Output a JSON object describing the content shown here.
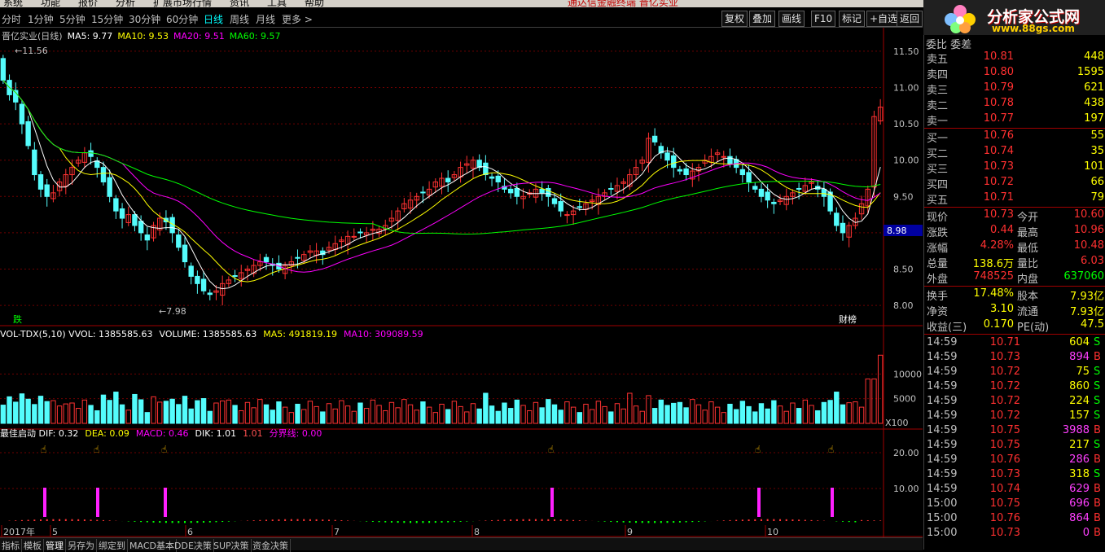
{
  "menu": {
    "items": [
      "系统",
      "功能",
      "报价",
      "分析",
      "扩展市场行情",
      "资讯",
      "工具",
      "帮助"
    ],
    "center": "通达信金融终端   晋亿实业"
  },
  "logo": {
    "title": "分析家公式网",
    "url": "www.88gs.com"
  },
  "toolbar": {
    "periods": [
      "分时",
      "1分钟",
      "5分钟",
      "15分钟",
      "30分钟",
      "60分钟",
      "日线",
      "周线",
      "月线",
      "更多 >"
    ],
    "active_period": "日线",
    "buttons": [
      "复权",
      "叠加",
      "画线",
      "F10",
      "标记",
      "+自选",
      "返回"
    ]
  },
  "main_chart": {
    "legend_title": "晋亿实业(日线)",
    "ma": [
      {
        "label": "MA5: 9.77",
        "color": "#ffffff"
      },
      {
        "label": "MA10: 9.53",
        "color": "#ffff00"
      },
      {
        "label": "MA20: 9.51",
        "color": "#ff00ff"
      },
      {
        "label": "MA60: 9.57",
        "color": "#00ff00"
      }
    ],
    "high_label": "11.56",
    "low_label": "7.98",
    "current_marker": "8.98",
    "event_left": "跌",
    "event_right": "财榜",
    "y_ticks": [
      "11.50",
      "11.00",
      "10.50",
      "10.00",
      "9.50",
      "9.00",
      "8.50",
      "8.00"
    ]
  },
  "volume_chart": {
    "legend": [
      {
        "label": "VOL-TDX(5,10)  VVOL: 1385585.63",
        "color": "#ffffff"
      },
      {
        "label": "VOLUME: 1385585.63",
        "color": "#ffffff"
      },
      {
        "label": "MA5: 491819.19",
        "color": "#ffff00"
      },
      {
        "label": "MA10: 309089.59",
        "color": "#ff00ff"
      }
    ],
    "y_ticks": [
      "10000",
      "5000"
    ],
    "unit": "X100"
  },
  "macd_chart": {
    "legend": [
      {
        "label": "最佳启动  DIF: 0.32",
        "color": "#ffffff"
      },
      {
        "label": "DEA: 0.09",
        "color": "#ffff00"
      },
      {
        "label": "MACD: 0.46",
        "color": "#ff00ff"
      },
      {
        "label": "DIK: 1.01",
        "color": "#ffffff"
      },
      {
        "label": "1.01",
        "color": "#ff5050"
      },
      {
        "label": "分界线: 0.00",
        "color": "#ff00ff"
      }
    ],
    "y_ticks": [
      "20.00",
      "10.00"
    ]
  },
  "x_axis": {
    "labels": [
      "2017年",
      "5",
      "6",
      "7",
      "8",
      "9",
      "10"
    ]
  },
  "bottom_tabs": [
    "指标",
    "模板",
    "管理",
    "另存为",
    "绑定到",
    "MACD基本",
    "DDE决策",
    "SUP决策",
    "资金决策"
  ],
  "bottom_active": "管理",
  "quote": {
    "header": "委比  委差",
    "sell": [
      {
        "label": "卖五",
        "price": "10.81",
        "vol": "448"
      },
      {
        "label": "卖四",
        "price": "10.80",
        "vol": "1595"
      },
      {
        "label": "卖三",
        "price": "10.79",
        "vol": "621"
      },
      {
        "label": "卖二",
        "price": "10.78",
        "vol": "438"
      },
      {
        "label": "卖一",
        "price": "10.77",
        "vol": "197"
      }
    ],
    "buy": [
      {
        "label": "买一",
        "price": "10.76",
        "vol": "55"
      },
      {
        "label": "买二",
        "price": "10.74",
        "vol": "35"
      },
      {
        "label": "买三",
        "price": "10.73",
        "vol": "101"
      },
      {
        "label": "买四",
        "price": "10.72",
        "vol": "66"
      },
      {
        "label": "买五",
        "price": "10.71",
        "vol": "79"
      }
    ],
    "stats1": [
      {
        "l1": "现价",
        "v1": "10.73",
        "c1": "#ff3030",
        "l2": "今开",
        "v2": "10.60",
        "c2": "#ff3030"
      },
      {
        "l1": "涨跌",
        "v1": "0.44",
        "c1": "#ff3030",
        "l2": "最高",
        "v2": "10.96",
        "c2": "#ff3030"
      },
      {
        "l1": "涨幅",
        "v1": "4.28%",
        "c1": "#ff3030",
        "l2": "最低",
        "v2": "10.48",
        "c2": "#ff3030"
      },
      {
        "l1": "总量",
        "v1": "138.6万",
        "c1": "#ffff00",
        "l2": "量比",
        "v2": "6.03",
        "c2": "#ff3030"
      },
      {
        "l1": "外盘",
        "v1": "748525",
        "c1": "#ff3030",
        "l2": "内盘",
        "v2": "637060",
        "c2": "#00ff00"
      }
    ],
    "stats2": [
      {
        "l1": "换手",
        "v1": "17.48%",
        "l2": "股本",
        "v2": "7.93亿"
      },
      {
        "l1": "净资",
        "v1": "3.10",
        "l2": "流通",
        "v2": "7.93亿"
      },
      {
        "l1": "收益(三)",
        "v1": "0.170",
        "l2": "PE(动)",
        "v2": "47.5"
      }
    ],
    "ticks": [
      {
        "time": "14:59",
        "price": "10.71",
        "vol": "604",
        "side": "S"
      },
      {
        "time": "14:59",
        "price": "10.73",
        "vol": "894",
        "side": "B"
      },
      {
        "time": "14:59",
        "price": "10.72",
        "vol": "75",
        "side": "S"
      },
      {
        "time": "14:59",
        "price": "10.72",
        "vol": "860",
        "side": "S"
      },
      {
        "time": "14:59",
        "price": "10.72",
        "vol": "224",
        "side": "S"
      },
      {
        "time": "14:59",
        "price": "10.72",
        "vol": "157",
        "side": "S"
      },
      {
        "time": "14:59",
        "price": "10.75",
        "vol": "3988",
        "side": "B"
      },
      {
        "time": "14:59",
        "price": "10.75",
        "vol": "217",
        "side": "S"
      },
      {
        "time": "14:59",
        "price": "10.76",
        "vol": "286",
        "side": "B"
      },
      {
        "time": "14:59",
        "price": "10.73",
        "vol": "318",
        "side": "S"
      },
      {
        "time": "14:59",
        "price": "10.74",
        "vol": "629",
        "side": "B"
      },
      {
        "time": "15:00",
        "price": "10.75",
        "vol": "696",
        "side": "B"
      },
      {
        "time": "15:00",
        "price": "10.76",
        "vol": "864",
        "side": "B"
      },
      {
        "time": "15:00",
        "price": "10.73",
        "vol": "0",
        "side": "B"
      }
    ]
  },
  "chart_data": {
    "type": "candlestick",
    "ylim": [
      7.9,
      11.6
    ],
    "closes": [
      11.1,
      10.9,
      10.8,
      10.5,
      10.2,
      9.8,
      9.6,
      9.5,
      9.55,
      9.7,
      9.8,
      9.9,
      10.0,
      10.1,
      10.05,
      9.9,
      9.7,
      9.5,
      9.3,
      9.2,
      9.25,
      9.1,
      9.0,
      8.9,
      9.1,
      9.2,
      9.15,
      9.0,
      8.8,
      8.6,
      8.4,
      8.3,
      8.2,
      8.15,
      8.2,
      8.3,
      8.35,
      8.4,
      8.45,
      8.5,
      8.55,
      8.6,
      8.6,
      8.55,
      8.5,
      8.55,
      8.6,
      8.65,
      8.7,
      8.75,
      8.75,
      8.7,
      8.8,
      8.85,
      8.9,
      8.95,
      8.95,
      9.0,
      9.0,
      9.05,
      9.05,
      9.1,
      9.2,
      9.3,
      9.4,
      9.45,
      9.5,
      9.55,
      9.6,
      9.7,
      9.75,
      9.7,
      9.8,
      9.9,
      9.95,
      10.0,
      9.9,
      9.8,
      9.75,
      9.7,
      9.6,
      9.55,
      9.5,
      9.5,
      9.55,
      9.6,
      9.55,
      9.5,
      9.4,
      9.3,
      9.25,
      9.3,
      9.35,
      9.4,
      9.45,
      9.5,
      9.55,
      9.6,
      9.65,
      9.7,
      9.8,
      9.9,
      10.0,
      10.3,
      10.25,
      10.1,
      10.0,
      9.9,
      9.85,
      9.8,
      9.85,
      9.9,
      10.0,
      10.05,
      10.1,
      10.05,
      9.95,
      9.9,
      9.8,
      9.7,
      9.6,
      9.5,
      9.45,
      9.4,
      9.45,
      9.5,
      9.55,
      9.6,
      9.65,
      9.7,
      9.6,
      9.5,
      9.3,
      9.1,
      9.0,
      9.1,
      9.2,
      9.4,
      9.6,
      10.6,
      10.73
    ]
  }
}
